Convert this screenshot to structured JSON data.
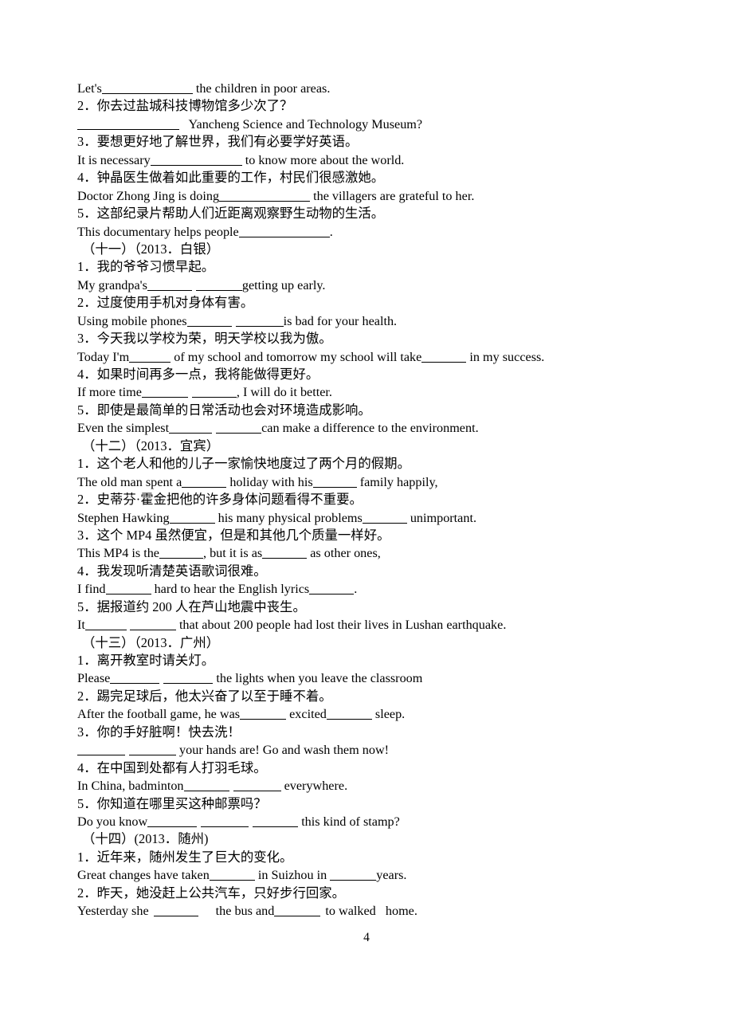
{
  "document": {
    "page_number": "4",
    "language_mix": "chinese-english",
    "text_color": "#000000",
    "background_color": "#ffffff"
  },
  "lines": [
    {
      "id": "l01",
      "type": "english",
      "text": "Let's",
      "tail": "the children in poor areas."
    },
    {
      "id": "l02",
      "type": "chinese",
      "text": "2．你去过盐城科技博物馆多少次了？"
    },
    {
      "id": "l03",
      "type": "english",
      "text": "",
      "tail": "Yancheng Science and Technology Museum?"
    },
    {
      "id": "l04",
      "type": "chinese",
      "text": "3．要想更好地了解世界，我们有必要学好英语。"
    },
    {
      "id": "l05",
      "type": "english",
      "text": "It is necessary",
      "tail": "to know more about the world."
    },
    {
      "id": "l06",
      "type": "chinese",
      "text": "4．钟晶医生做着如此重要的工作，村民们很感激她。"
    },
    {
      "id": "l07",
      "type": "english",
      "text": "Doctor Zhong Jing is doing",
      "tail": "the villagers are grateful to her."
    },
    {
      "id": "l08",
      "type": "chinese",
      "text": "5．这部纪录片帮助人们近距离观察野生动物的生活。"
    },
    {
      "id": "l09",
      "type": "english",
      "text": "This documentary helps people",
      "tail": "."
    },
    {
      "id": "l10",
      "type": "heading",
      "text": "（十一）（2013．白银）"
    },
    {
      "id": "l11",
      "type": "chinese",
      "text": "1．我的爷爷习惯早起。"
    },
    {
      "id": "l12",
      "type": "english",
      "text": "My grandpa's",
      "tail": "getting up early."
    },
    {
      "id": "l13",
      "type": "chinese",
      "text": "2．过度使用手机对身体有害。"
    },
    {
      "id": "l14",
      "type": "english",
      "text": "Using mobile phones",
      "tail": "is bad for your health."
    },
    {
      "id": "l15",
      "type": "chinese",
      "text": "3．今天我以学校为荣，明天学校以我为傲。"
    },
    {
      "id": "l16",
      "type": "english",
      "text": "Today I'm",
      "mid": "of my school and tomorrow my school will take",
      "tail": "in my success."
    },
    {
      "id": "l17",
      "type": "chinese",
      "text": "4．如果时间再多一点，我将能做得更好。"
    },
    {
      "id": "l18",
      "type": "english",
      "text": "If more time",
      "tail": ", I will do it better."
    },
    {
      "id": "l19",
      "type": "chinese",
      "text": "5．即使是最简单的日常活动也会对环境造成影响。"
    },
    {
      "id": "l20",
      "type": "english",
      "text": "Even the simplest",
      "tail": "can make a difference to the environment."
    },
    {
      "id": "l21",
      "type": "heading",
      "text": "（十二）（2013．宜宾）"
    },
    {
      "id": "l22",
      "type": "chinese",
      "text": "1．这个老人和他的儿子一家愉快地度过了两个月的假期。"
    },
    {
      "id": "l23",
      "type": "english",
      "text": "The old man spent a",
      "mid": "holiday with his",
      "tail": "family happily,"
    },
    {
      "id": "l24",
      "type": "chinese",
      "text": "2．史蒂芬·霍金把他的许多身体问题看得不重要。"
    },
    {
      "id": "l25",
      "type": "english",
      "text": "Stephen Hawking",
      "mid": "his many physical problems",
      "tail": "unimportant."
    },
    {
      "id": "l26",
      "type": "chinese",
      "text": "3．这个 MP4 虽然便宜，但是和其他几个质量一样好。"
    },
    {
      "id": "l27",
      "type": "english",
      "text": "This MP4 is the",
      "mid": ", but it is as",
      "tail": "as other ones,"
    },
    {
      "id": "l28",
      "type": "chinese",
      "text": "4．我发现听清楚英语歌词很难。"
    },
    {
      "id": "l29",
      "type": "english",
      "text": "I find",
      "mid": "hard to hear the English lyrics",
      "tail": "."
    },
    {
      "id": "l30",
      "type": "chinese",
      "text": "5．据报道约 200 人在芦山地震中丧生。"
    },
    {
      "id": "l31",
      "type": "english",
      "text": "It",
      "tail": "that about 200 people had lost their lives in Lushan earthquake."
    },
    {
      "id": "l32",
      "type": "heading",
      "text": "（十三）（2013．广州）"
    },
    {
      "id": "l33",
      "type": "chinese",
      "text": "1．离开教室时请关灯。"
    },
    {
      "id": "l34",
      "type": "english",
      "text": "Please",
      "tail": "the lights when you leave the classroom"
    },
    {
      "id": "l35",
      "type": "chinese",
      "text": "2．踢完足球后，他太兴奋了以至于睡不着。"
    },
    {
      "id": "l36",
      "type": "english",
      "text": "After the football game, he was",
      "mid": "excited",
      "tail": "sleep."
    },
    {
      "id": "l37",
      "type": "chinese",
      "text": "3．你的手好脏啊！快去洗！"
    },
    {
      "id": "l38",
      "type": "english",
      "text": "",
      "tail": "your hands are! Go and wash them now!"
    },
    {
      "id": "l39",
      "type": "chinese",
      "text": "4．在中国到处都有人打羽毛球。"
    },
    {
      "id": "l40",
      "type": "english",
      "text": "In China, badminton",
      "tail": "everywhere."
    },
    {
      "id": "l41",
      "type": "chinese",
      "text": "5．你知道在哪里买这种邮票吗？"
    },
    {
      "id": "l42",
      "type": "english",
      "text": "Do you know",
      "tail": "this kind of stamp?"
    },
    {
      "id": "l43",
      "type": "heading",
      "text": "（十四）(2013．随州)"
    },
    {
      "id": "l44",
      "type": "chinese",
      "text": "1．近年来，随州发生了巨大的变化。"
    },
    {
      "id": "l45",
      "type": "english",
      "text": "Great changes have taken",
      "mid": "in Suizhou in",
      "tail": "years."
    },
    {
      "id": "l46",
      "type": "chinese",
      "text": "2．昨天，她没赶上公共汽车，只好步行回家。"
    },
    {
      "id": "l47",
      "type": "english",
      "text": "Yesterday she",
      "mid": "the bus and",
      "tail": "to walked   home."
    }
  ],
  "line_text": {
    "l01_a": "Let's",
    "l01_b": " the children in poor areas.",
    "l02": "2．你去过盐城科技博物馆多少次了？",
    "l03_b": " Yancheng Science and Technology Museum?",
    "l04": "3．要想更好地了解世界，我们有必要学好英语。",
    "l05_a": "It is necessary",
    "l05_b": " to know more about the world.",
    "l06": "4．钟晶医生做着如此重要的工作，村民们很感激她。",
    "l07_a": "Doctor Zhong Jing is doing",
    "l07_b": " the villagers are grateful to her.",
    "l08": "5．这部纪录片帮助人们近距离观察野生动物的生活。",
    "l09_a": "This documentary helps people",
    "l09_b": ".",
    "l10": "（十一）（2013．白银）",
    "l11": "1．我的爷爷习惯早起。",
    "l12_a": "My grandpa's",
    "l12_b": "getting up early.",
    "l13": "2．过度使用手机对身体有害。",
    "l14_a": "Using mobile phones",
    "l14_b": "is bad for your health.",
    "l15": "3．今天我以学校为荣，明天学校以我为傲。",
    "l16_a": "Today I'm",
    "l16_b": " of my school and tomorrow my school will take",
    "l16_c": " in my success.",
    "l17": "4．如果时间再多一点，我将能做得更好。",
    "l18_a": "If more time",
    "l18_b": ", I will do it better.",
    "l19": "5．即使是最简单的日常活动也会对环境造成影响。",
    "l20_a": "Even the simplest",
    "l20_b": "can make a difference to the environment.",
    "l21": "（十二）（2013．宜宾）",
    "l22": "1．这个老人和他的儿子一家愉快地度过了两个月的假期。",
    "l23_a": "The old man spent a",
    "l23_b": " holiday with his",
    "l23_c": " family happily,",
    "l24": "2．史蒂芬·霍金把他的许多身体问题看得不重要。",
    "l25_a": "Stephen Hawking",
    "l25_b": " his many physical problems",
    "l25_c": " unimportant.",
    "l26": "3．这个 MP4 虽然便宜，但是和其他几个质量一样好。",
    "l27_a": "This MP4 is the",
    "l27_b": ", but it is as",
    "l27_c": " as other ones,",
    "l28": "4．我发现听清楚英语歌词很难。",
    "l29_a": "I find",
    "l29_b": " hard to hear the English lyrics",
    "l29_c": ".",
    "l30": "5．据报道约 200 人在芦山地震中丧生。",
    "l31_a": "It",
    "l31_b": " that about 200 people had lost their lives in Lushan earthquake.",
    "l32": "（十三）（2013．广州）",
    "l33": "1．离开教室时请关灯。",
    "l34_a": "Please",
    "l34_b": " the lights when you leave the classroom",
    "l35": "2．踢完足球后，他太兴奋了以至于睡不着。",
    "l36_a": "After the football game, he was",
    "l36_b": " excited",
    "l36_c": " sleep.",
    "l37": "3．你的手好脏啊！快去洗！",
    "l38_b": " your hands are! Go and wash them now!",
    "l39": "4．在中国到处都有人打羽毛球。",
    "l40_a": "In China, badminton",
    "l40_b": " everywhere.",
    "l41": "5．你知道在哪里买这种邮票吗？",
    "l42_a": "Do you know",
    "l42_b": " this kind of stamp?",
    "l43": "（十四）(2013．随州)",
    "l44": "1．近年来，随州发生了巨大的变化。",
    "l45_a": "Great changes have taken",
    "l45_b": " in Suizhou in ",
    "l45_c": "years.",
    "l46": "2．昨天，她没赶上公共汽车，只好步行回家。",
    "l47_a": "Yesterday she",
    "l47_b": "the bus and",
    "l47_c": "to walked   home."
  },
  "footer": {
    "page_number": "4"
  }
}
